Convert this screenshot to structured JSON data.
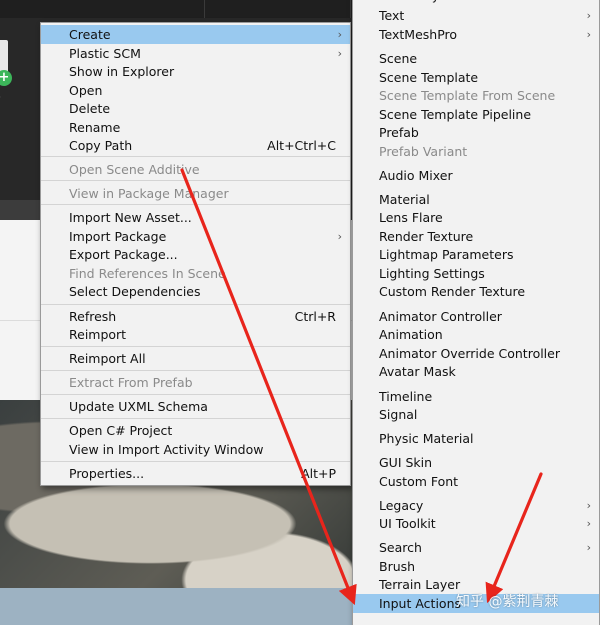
{
  "background": {
    "asset_badge": "+",
    "asset_label": "o"
  },
  "main_menu": {
    "items": [
      {
        "label": "Create",
        "shortcut": "",
        "submenu": true,
        "disabled": false,
        "highlighted": true
      },
      {
        "label": "Plastic SCM",
        "shortcut": "",
        "submenu": true,
        "disabled": false
      },
      {
        "label": "Show in Explorer",
        "shortcut": "",
        "submenu": false,
        "disabled": false
      },
      {
        "label": "Open",
        "shortcut": "",
        "submenu": false,
        "disabled": false
      },
      {
        "label": "Delete",
        "shortcut": "",
        "submenu": false,
        "disabled": false
      },
      {
        "label": "Rename",
        "shortcut": "",
        "submenu": false,
        "disabled": false
      },
      {
        "label": "Copy Path",
        "shortcut": "Alt+Ctrl+C",
        "submenu": false,
        "disabled": false
      },
      {
        "label": "Open Scene Additive",
        "shortcut": "",
        "submenu": false,
        "disabled": true
      },
      {
        "label": "View in Package Manager",
        "shortcut": "",
        "submenu": false,
        "disabled": true
      },
      {
        "label": "Import New Asset...",
        "shortcut": "",
        "submenu": false,
        "disabled": false
      },
      {
        "label": "Import Package",
        "shortcut": "",
        "submenu": true,
        "disabled": false
      },
      {
        "label": "Export Package...",
        "shortcut": "",
        "submenu": false,
        "disabled": false
      },
      {
        "label": "Find References In Scene",
        "shortcut": "",
        "submenu": false,
        "disabled": true
      },
      {
        "label": "Select Dependencies",
        "shortcut": "",
        "submenu": false,
        "disabled": false
      },
      {
        "label": "Refresh",
        "shortcut": "Ctrl+R",
        "submenu": false,
        "disabled": false
      },
      {
        "label": "Reimport",
        "shortcut": "",
        "submenu": false,
        "disabled": false
      },
      {
        "label": "Reimport All",
        "shortcut": "",
        "submenu": false,
        "disabled": false
      },
      {
        "label": "Extract From Prefab",
        "shortcut": "",
        "submenu": false,
        "disabled": true
      },
      {
        "label": "Update UXML Schema",
        "shortcut": "",
        "submenu": false,
        "disabled": false
      },
      {
        "label": "Open C# Project",
        "shortcut": "",
        "submenu": false,
        "disabled": false
      },
      {
        "label": "View in Import Activity Window",
        "shortcut": "",
        "submenu": false,
        "disabled": false
      },
      {
        "label": "Properties...",
        "shortcut": "Alt+P",
        "submenu": false,
        "disabled": false
      }
    ]
  },
  "create_submenu": {
    "items": [
      {
        "label": "Assembly Definition Reference",
        "submenu": false,
        "disabled": false
      },
      {
        "label": "Text",
        "submenu": true,
        "disabled": false
      },
      {
        "label": "TextMeshPro",
        "submenu": true,
        "disabled": false
      },
      {
        "label": "Scene",
        "submenu": false,
        "disabled": false
      },
      {
        "label": "Scene Template",
        "submenu": false,
        "disabled": false
      },
      {
        "label": "Scene Template From Scene",
        "submenu": false,
        "disabled": true
      },
      {
        "label": "Scene Template Pipeline",
        "submenu": false,
        "disabled": false
      },
      {
        "label": "Prefab",
        "submenu": false,
        "disabled": false
      },
      {
        "label": "Prefab Variant",
        "submenu": false,
        "disabled": true
      },
      {
        "label": "Audio Mixer",
        "submenu": false,
        "disabled": false
      },
      {
        "label": "Material",
        "submenu": false,
        "disabled": false
      },
      {
        "label": "Lens Flare",
        "submenu": false,
        "disabled": false
      },
      {
        "label": "Render Texture",
        "submenu": false,
        "disabled": false
      },
      {
        "label": "Lightmap Parameters",
        "submenu": false,
        "disabled": false
      },
      {
        "label": "Lighting Settings",
        "submenu": false,
        "disabled": false
      },
      {
        "label": "Custom Render Texture",
        "submenu": false,
        "disabled": false
      },
      {
        "label": "Animator Controller",
        "submenu": false,
        "disabled": false
      },
      {
        "label": "Animation",
        "submenu": false,
        "disabled": false
      },
      {
        "label": "Animator Override Controller",
        "submenu": false,
        "disabled": false
      },
      {
        "label": "Avatar Mask",
        "submenu": false,
        "disabled": false
      },
      {
        "label": "Timeline",
        "submenu": false,
        "disabled": false
      },
      {
        "label": "Signal",
        "submenu": false,
        "disabled": false
      },
      {
        "label": "Physic Material",
        "submenu": false,
        "disabled": false
      },
      {
        "label": "GUI Skin",
        "submenu": false,
        "disabled": false
      },
      {
        "label": "Custom Font",
        "submenu": false,
        "disabled": false
      },
      {
        "label": "Legacy",
        "submenu": true,
        "disabled": false
      },
      {
        "label": "UI Toolkit",
        "submenu": true,
        "disabled": false
      },
      {
        "label": "Search",
        "submenu": true,
        "disabled": false
      },
      {
        "label": "Brush",
        "submenu": false,
        "disabled": false
      },
      {
        "label": "Terrain Layer",
        "submenu": false,
        "disabled": false
      },
      {
        "label": "Input Actions",
        "submenu": false,
        "disabled": false,
        "highlighted": true
      }
    ]
  },
  "icons": {
    "submenu_arrow": "›"
  },
  "colors": {
    "menu_bg": "#f2f2f2",
    "highlight": "#99c9ef",
    "disabled_text": "#8a8a8a",
    "annotation_arrow": "#e8251c"
  },
  "watermark": "知乎 @紫荆青棘"
}
